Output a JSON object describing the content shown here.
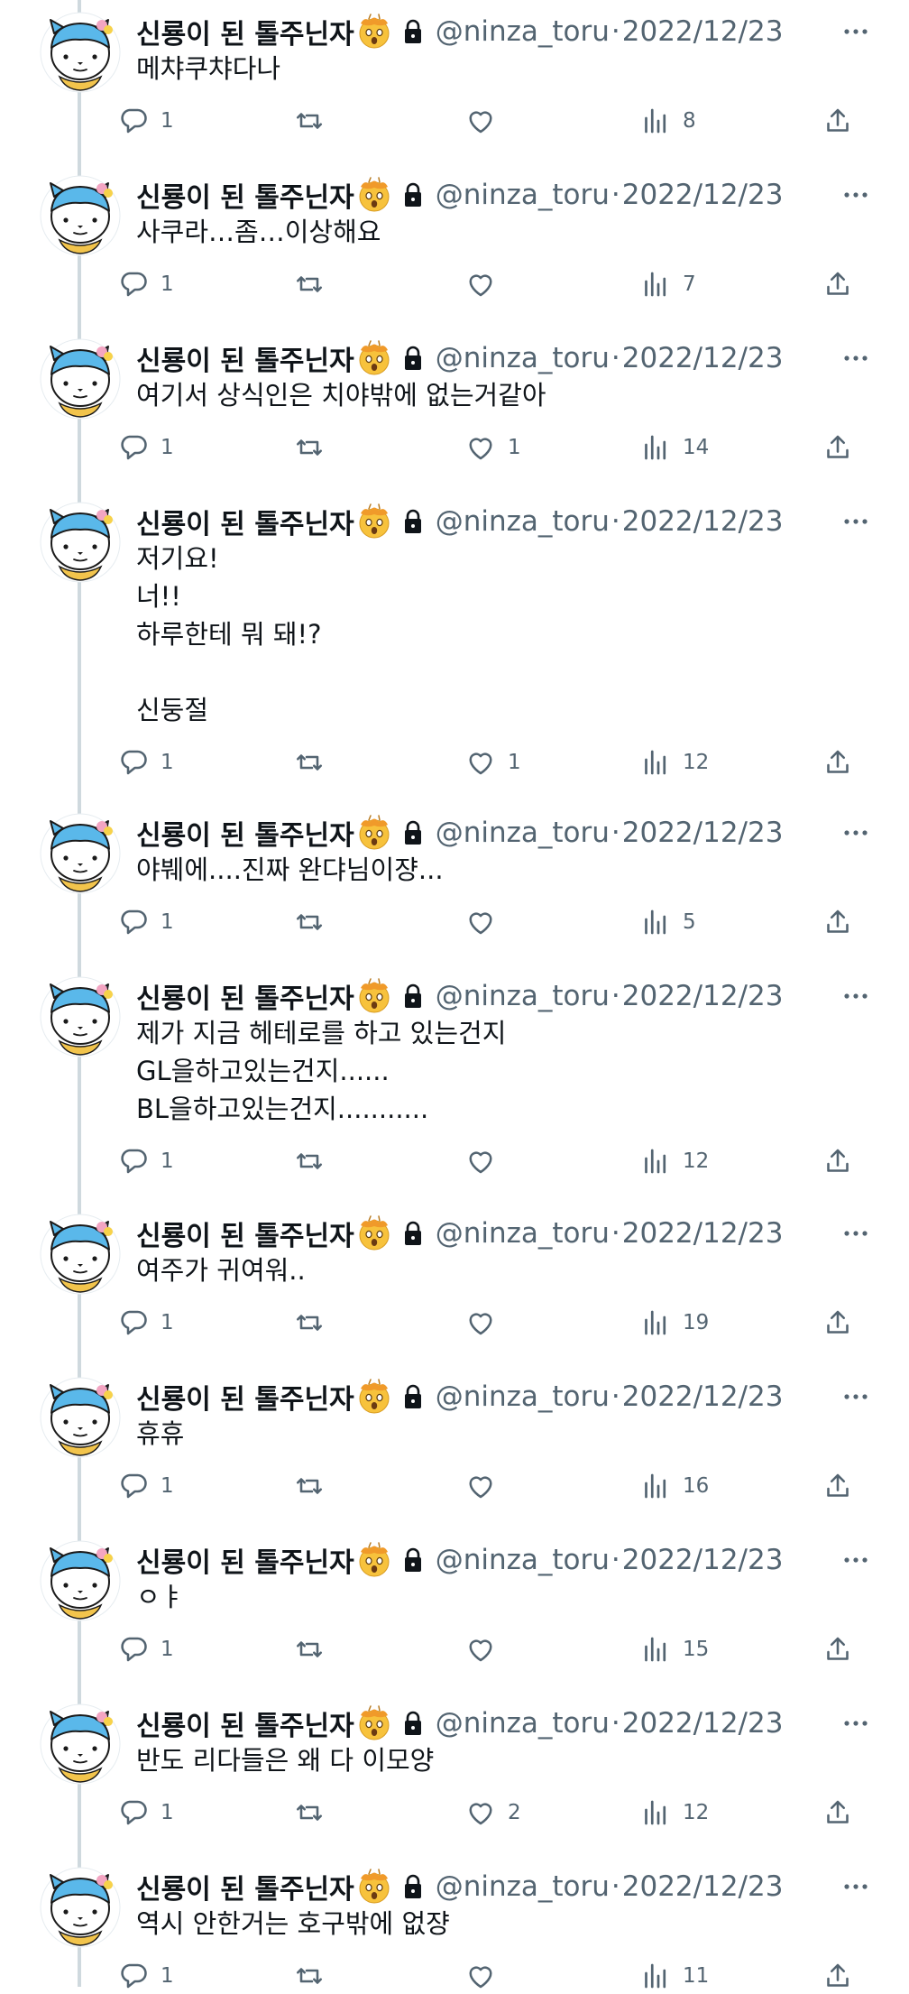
{
  "author": {
    "display_name": "신룡이 된 톨주닌자",
    "handle": "@ninza_toru",
    "dot": "·",
    "date": "2022/12/23"
  },
  "icons": {
    "avatar": "avatar-icon",
    "emoji": "exploding-head-emoji",
    "lock": "lock-icon",
    "more": "more-icon",
    "reply": "reply-icon",
    "retweet": "retweet-icon",
    "like": "like-icon",
    "views": "views-icon",
    "share": "share-icon"
  },
  "colors": {
    "text": "#0f1419",
    "secondary": "#536471",
    "thread_line": "#cfd9de",
    "avatar_blue": "#5ab8ea"
  },
  "tweets": [
    {
      "text": "메챠쿠챠다나",
      "replies": "1",
      "retweets": "",
      "likes": "",
      "views": "8"
    },
    {
      "text": "사쿠라…좀…이상해요",
      "replies": "1",
      "retweets": "",
      "likes": "",
      "views": "7"
    },
    {
      "text": "여기서 상식인은 치야밖에 없는거같아",
      "replies": "1",
      "retweets": "",
      "likes": "1",
      "views": "14"
    },
    {
      "text": "저기요!\n너!!\n하루한테 뭐 돼!?\n\n신둥절",
      "replies": "1",
      "retweets": "",
      "likes": "1",
      "views": "12"
    },
    {
      "text": "야붸에....진짜 완댜님이쟝...",
      "replies": "1",
      "retweets": "",
      "likes": "",
      "views": "5"
    },
    {
      "text": "제가 지금 헤테로를 하고 있는건지\nGL을하고있는건지......\nBL을하고있는건지...........",
      "replies": "1",
      "retweets": "",
      "likes": "",
      "views": "12"
    },
    {
      "text": "여주가 귀여워..",
      "replies": "1",
      "retweets": "",
      "likes": "",
      "views": "19"
    },
    {
      "text": "휴휴",
      "replies": "1",
      "retweets": "",
      "likes": "",
      "views": "16"
    },
    {
      "text": "ㅇㅑ",
      "replies": "1",
      "retweets": "",
      "likes": "",
      "views": "15"
    },
    {
      "text": "반도 리다들은 왜 다 이모양",
      "replies": "1",
      "retweets": "",
      "likes": "2",
      "views": "12"
    },
    {
      "text": "역시 안한거는 호구밖에 없쟝",
      "replies": "1",
      "retweets": "",
      "likes": "",
      "views": "11"
    }
  ]
}
